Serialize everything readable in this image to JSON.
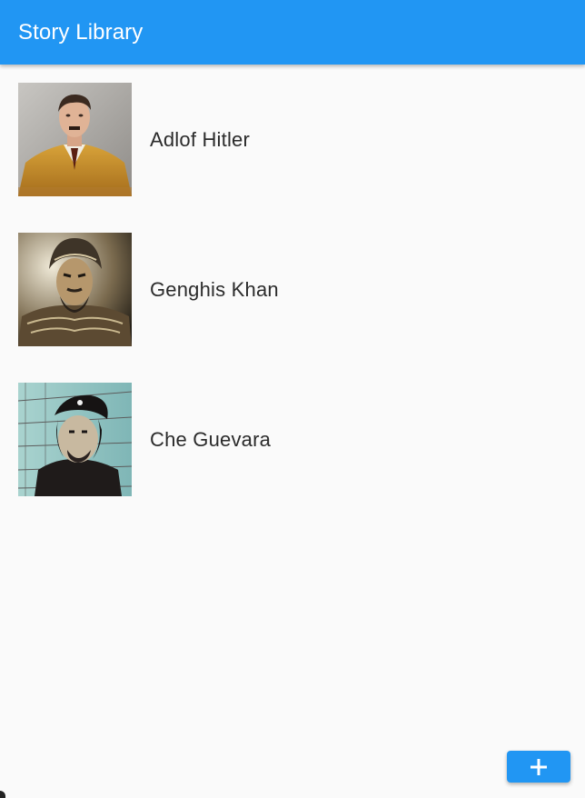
{
  "app_bar": {
    "title": "Story Library"
  },
  "stories": [
    {
      "name": "Adlof Hitler",
      "thumbnail": "portrait-military-uniform"
    },
    {
      "name": "Genghis Khan",
      "thumbnail": "portrait-helmet-warrior"
    },
    {
      "name": "Che Guevara",
      "thumbnail": "portrait-beret-mural"
    }
  ],
  "fab": {
    "icon": "plus-icon"
  },
  "colors": {
    "primary": "#2196f3",
    "background": "#fafafa",
    "text": "#2b2b2b",
    "on_primary": "#ffffff"
  }
}
